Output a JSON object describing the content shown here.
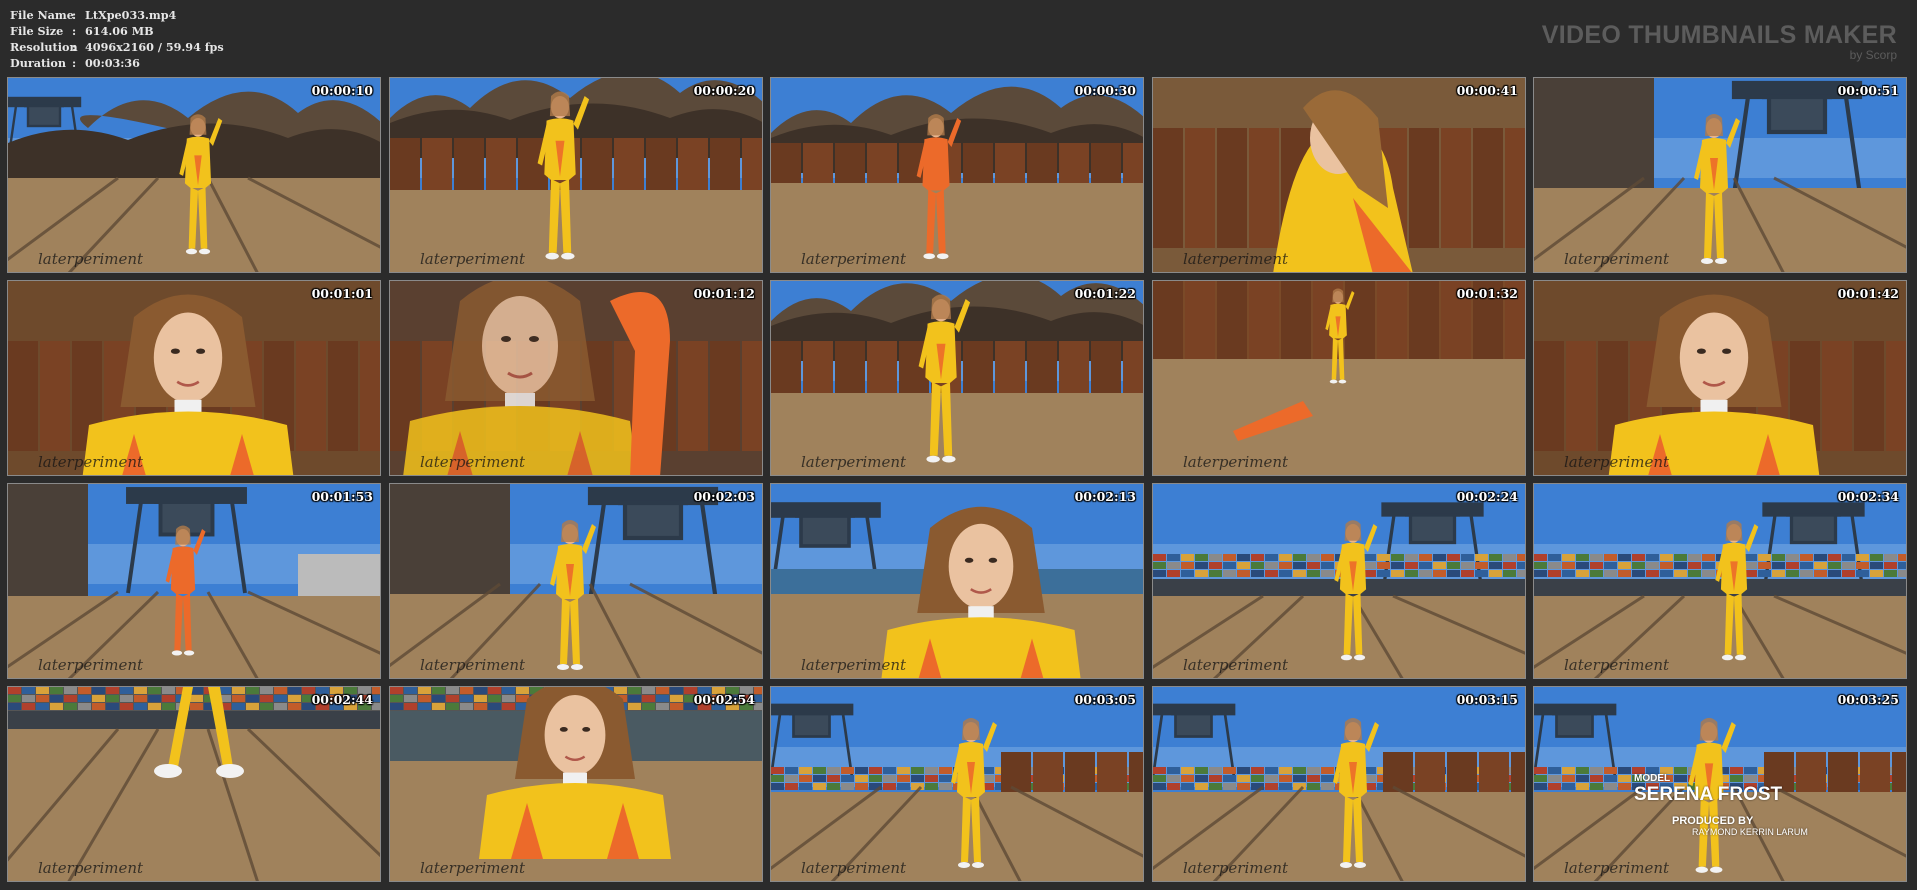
{
  "file_info": [
    {
      "key": "File Name",
      "sep": ":",
      "value": "LtXpe033.mp4"
    },
    {
      "key": "File Size",
      "sep": ":",
      "value": "614.06 MB"
    },
    {
      "key": "Resolution",
      "sep": ":",
      "value": "4096x2160 / 59.94 fps"
    },
    {
      "key": "Duration",
      "sep": ":",
      "value": "00:03:36"
    }
  ],
  "brand": {
    "title": "VIDEO THUMBNAILS MAKER",
    "subtitle": "by Scorp"
  },
  "watermark": "laterperiment",
  "credits": {
    "model_label": "MODEL",
    "model_name": "SERENA FROST",
    "produced_label": "PRODUCED  BY",
    "producer_name": "RAYMOND KERRIN LARUM"
  },
  "thumbnails": [
    {
      "time": "00:00:10",
      "scene": "port-wide"
    },
    {
      "time": "00:00:20",
      "scene": "scrap-pose"
    },
    {
      "time": "00:00:30",
      "scene": "scrap-back"
    },
    {
      "time": "00:00:41",
      "scene": "closeup-side"
    },
    {
      "time": "00:00:51",
      "scene": "crane-walk"
    },
    {
      "time": "00:01:01",
      "scene": "closeup-face"
    },
    {
      "time": "00:01:12",
      "scene": "closeup-blur"
    },
    {
      "time": "00:01:22",
      "scene": "scrap-pose"
    },
    {
      "time": "00:01:32",
      "scene": "crouch"
    },
    {
      "time": "00:01:42",
      "scene": "closeup-face"
    },
    {
      "time": "00:01:53",
      "scene": "crane-back"
    },
    {
      "time": "00:02:03",
      "scene": "crane-walk"
    },
    {
      "time": "00:02:13",
      "scene": "portrait-port"
    },
    {
      "time": "00:02:24",
      "scene": "containers"
    },
    {
      "time": "00:02:34",
      "scene": "containers"
    },
    {
      "time": "00:02:44",
      "scene": "legs"
    },
    {
      "time": "00:02:54",
      "scene": "bust-port"
    },
    {
      "time": "00:03:05",
      "scene": "port-walk"
    },
    {
      "time": "00:03:15",
      "scene": "port-walk"
    },
    {
      "time": "00:03:25",
      "scene": "credits"
    }
  ],
  "colors": {
    "background": "#2b2b2b",
    "catsuit_yellow": "#f2c21c",
    "catsuit_orange": "#ec6a2a",
    "sky": "#3d7fd3",
    "ground": "#a0825c"
  }
}
